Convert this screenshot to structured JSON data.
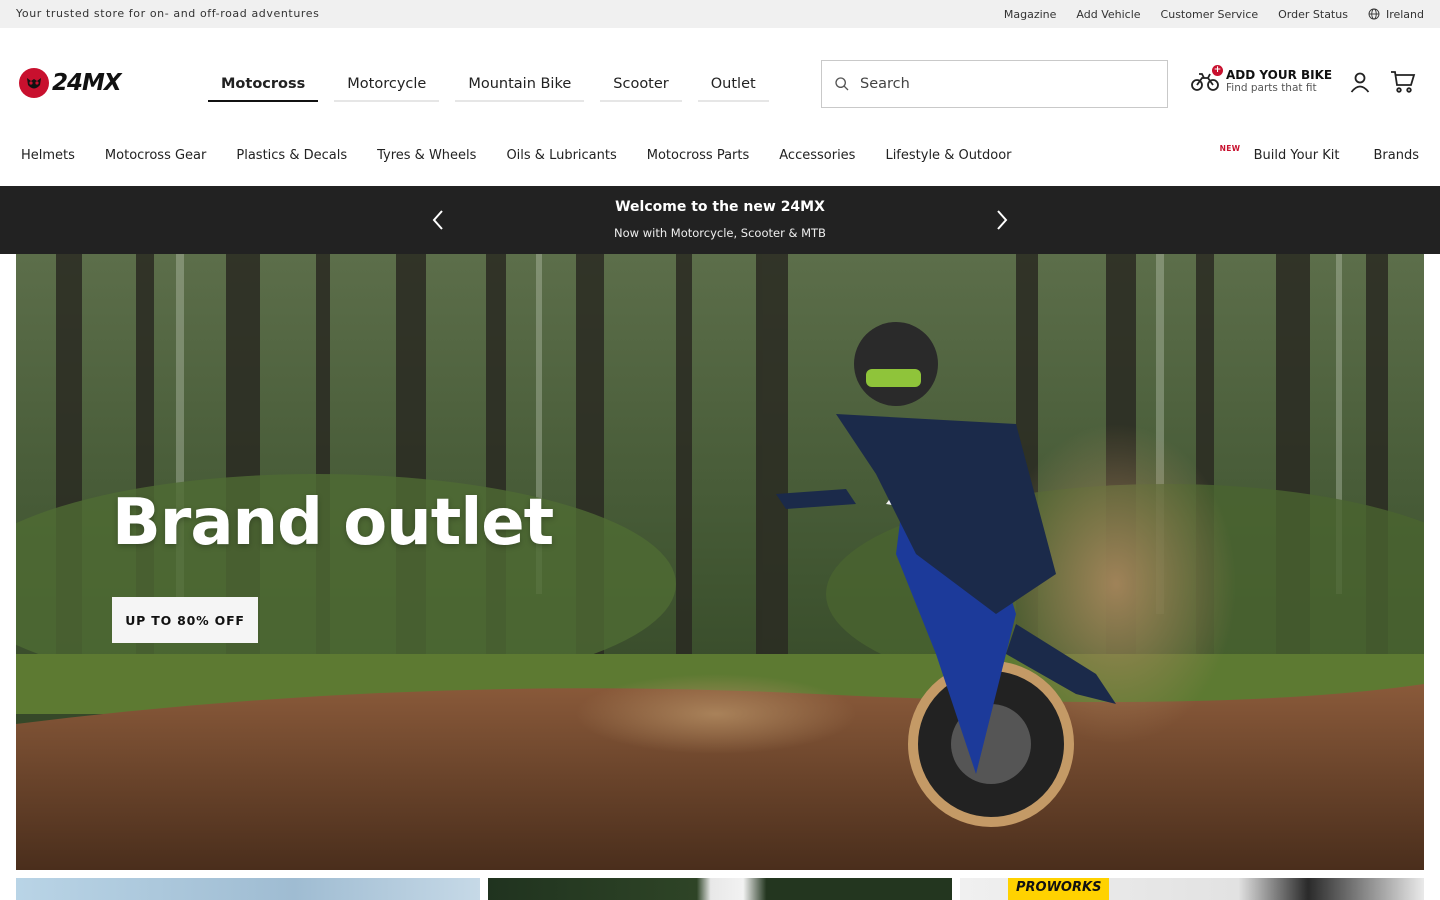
{
  "topbar": {
    "tagline": "Your trusted store for on- and off-road adventures",
    "links": [
      "Magazine",
      "Add Vehicle",
      "Customer Service",
      "Order Status"
    ],
    "region": "Ireland"
  },
  "header": {
    "logo_text": "24MX",
    "categories": [
      {
        "label": "Motocross",
        "active": true
      },
      {
        "label": "Motorcycle",
        "active": false
      },
      {
        "label": "Mountain Bike",
        "active": false
      },
      {
        "label": "Scooter",
        "active": false
      },
      {
        "label": "Outlet",
        "active": false
      }
    ],
    "search": {
      "placeholder": "Search"
    },
    "add_bike": {
      "title": "ADD YOUR BIKE",
      "subtitle": "Find parts that fit",
      "badge": "+"
    }
  },
  "subnav": {
    "items": [
      "Helmets",
      "Motocross Gear",
      "Plastics & Decals",
      "Tyres & Wheels",
      "Oils & Lubricants",
      "Motocross Parts",
      "Accessories",
      "Lifestyle & Outdoor"
    ],
    "right": [
      {
        "label": "Build Your Kit",
        "badge": "NEW"
      },
      {
        "label": "Brands"
      }
    ]
  },
  "announcement": {
    "title": "Welcome to the new 24MX",
    "subtitle": "Now with Motorcycle, Scooter & MTB"
  },
  "hero": {
    "title": "Brand outlet",
    "cta": "UP TO 80% OFF"
  },
  "tiles": {
    "proworks_label": "PROWORKS"
  },
  "colors": {
    "accent_red": "#c8102e",
    "announcement_bg": "#222222",
    "topbar_bg": "#f0f0f0"
  }
}
